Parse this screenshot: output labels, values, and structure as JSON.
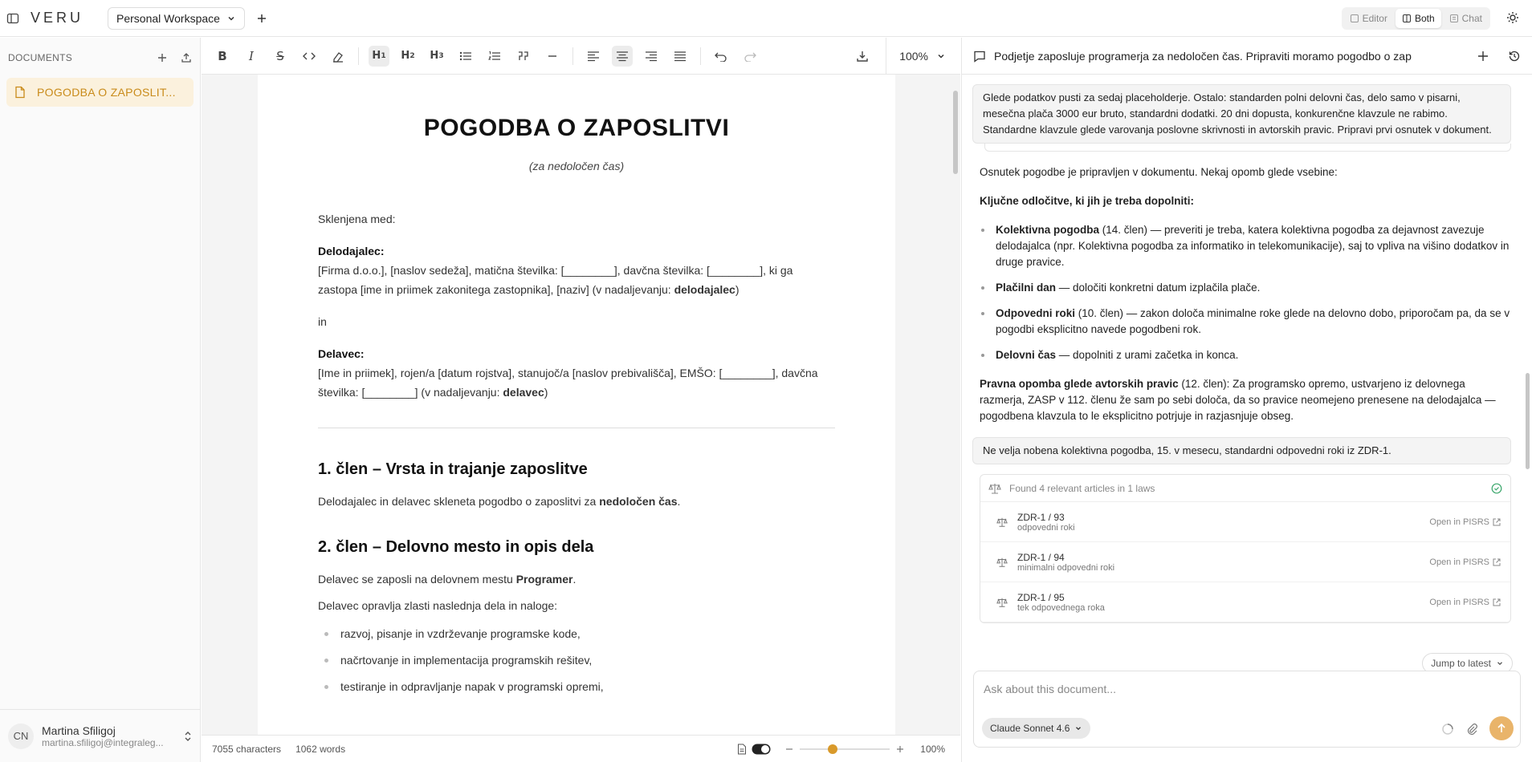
{
  "app": {
    "logo": "VERU",
    "workspace": "Personal Workspace"
  },
  "view_modes": [
    "Editor",
    "Both",
    "Chat"
  ],
  "active_view": "Both",
  "sidebar": {
    "heading": "DOCUMENTS",
    "items": [
      {
        "label": "POGODBA O ZAPOSLIT..."
      }
    ],
    "user": {
      "initials": "CN",
      "name": "Martina Sfiligoj",
      "email": "martina.sfiligoj@integraleg..."
    }
  },
  "toolbar": {
    "zoom": "100%"
  },
  "document": {
    "title": "POGODBA O ZAPOSLITVI",
    "subtitle": "(za nedoločen čas)",
    "intro": "Sklenjena med:",
    "employer_label": "Delodajalec:",
    "employer_text": "[Firma d.o.o.], [naslov sedeža], matična številka: [________], davčna številka: [________], ki ga zastopa [ime in priimek zakonitega zastopnika], [naziv] (v nadaljevanju: ",
    "employer_term": "delodajalec",
    "conj": "in",
    "employee_label": "Delavec:",
    "employee_text": "[Ime in priimek], rojen/a [datum rojstva], stanujoč/a [naslov prebivališča], EMŠO: [________], davčna številka: [________] (v nadaljevanju: ",
    "employee_term": "delavec",
    "close": ")",
    "s1_title": "1. člen – Vrsta in trajanje zaposlitve",
    "s1_text": "Delodajalec in delavec skleneta pogodbo o zaposlitvi za ",
    "s1_term": "nedoločen čas",
    "s1_end": ".",
    "s2_title": "2. člen – Delovno mesto in opis dela",
    "s2_text": "Delavec se zaposli na delovnem mestu ",
    "s2_term": "Programer",
    "s2_end": ".",
    "s2_text2": "Delavec opravlja zlasti naslednja dela in naloge:",
    "s2_items": [
      "razvoj, pisanje in vzdrževanje programske kode,",
      "načrtovanje in implementacija programskih rešitev,",
      "testiranje in odpravljanje napak v programski opremi,"
    ]
  },
  "status": {
    "chars": "7055 characters",
    "words": "1062 words",
    "zoom": "100%",
    "zoom_level": 0.35
  },
  "chat": {
    "title": "Podjetje zaposluje programerja za nedoločen čas. Pripraviti moramo pogodbo o zap",
    "user_msg_1": "Glede podatkov pusti za sedaj placeholderje. Ostalo: standarden polni delovni čas, delo samo v pisarni, mesečna plača 3000 eur bruto, standardni dodatki. 20 dni dopusta, konkurenčne klavzule ne rabimo. Standardne klavzule glede varovanja poslovne skrivnosti in avtorskih pravic. Pripravi prvi osnutek v dokument.",
    "reply_intro": "Osnutek pogodbe je pripravljen v dokumentu. Nekaj opomb glede vsebine:",
    "reply_heading": "Ključne odločitve, ki jih je treba dopolniti:",
    "bullets": [
      {
        "bold": "Kolektivna pogodba",
        "text": " (14. člen) — preveriti je treba, katera kolektivna pogodba za dejavnost zavezuje delodajalca (npr. Kolektivna pogodba za informatiko in telekomunikacije), saj to vpliva na višino dodatkov in druge pravice."
      },
      {
        "bold": "Plačilni dan",
        "text": " — določiti konkretni datum izplačila plače."
      },
      {
        "bold": "Odpovedni roki",
        "text": " (10. člen) — zakon določa minimalne roke glede na delovno dobo, priporočam pa, da se v pogodbi eksplicitno navede pogodbeni rok."
      },
      {
        "bold": "Delovni čas",
        "text": " — dopolniti z urami začetka in konca."
      }
    ],
    "note_bold": "Pravna opomba glede avtorskih pravic",
    "note_text": " (12. člen): Za programsko opremo, ustvarjeno iz delovnega razmerja, ZASP v 112. členu že sam po sebi določa, da so pravice neomejeno prenesene na delodajalca — pogodbena klavzula to le eksplicitno potrjuje in razjasnjuje obseg.",
    "user_msg_2": "Ne velja nobena kolektivna pogodba, 15. v mesecu, standardni odpovedni roki iz ZDR-1.",
    "tool_header": "Found 4 relevant articles in 1 laws",
    "articles": [
      {
        "id": "ZDR-1 / 93",
        "desc": "odpovedni roki",
        "link": "Open in PISRS"
      },
      {
        "id": "ZDR-1 / 94",
        "desc": "minimalni odpovedni roki",
        "link": "Open in PISRS"
      },
      {
        "id": "ZDR-1 / 95",
        "desc": "tek odpovednega roka",
        "link": "Open in PISRS"
      }
    ],
    "jump": "Jump to latest",
    "input_placeholder": "Ask about this document...",
    "model": "Claude Sonnet 4.6"
  }
}
